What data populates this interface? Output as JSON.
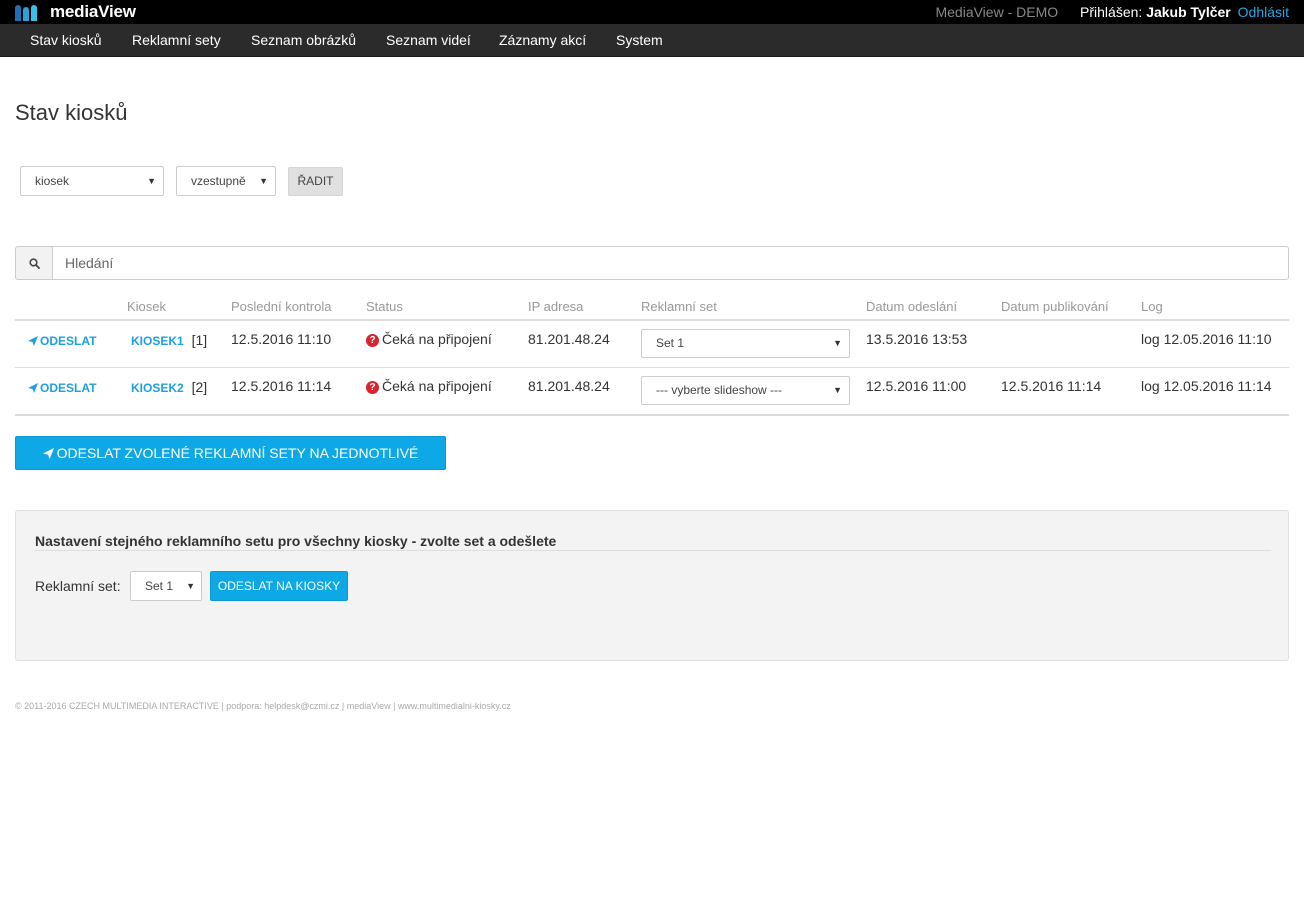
{
  "app": {
    "name": "mediaView",
    "demo_label": "MediaView - DEMO",
    "login_label": "Přihlášen: ",
    "user": "Jakub Tylčer",
    "logout": "Odhlásit"
  },
  "nav": [
    {
      "label": "Stav kiosků"
    },
    {
      "label": "Reklamní sety"
    },
    {
      "label": "Seznam obrázků"
    },
    {
      "label": "Seznam videí"
    },
    {
      "label": "Záznamy akcí"
    },
    {
      "label": "System"
    }
  ],
  "page_title": "Stav kiosků",
  "sort": {
    "field_value": "kiosek",
    "order_value": "vzestupně",
    "sort_button": "ŘADIT"
  },
  "search": {
    "placeholder": "Hledání",
    "icon": "search-icon"
  },
  "table": {
    "headers": [
      "Kiosek",
      "Poslední kontrola",
      "Status",
      "IP adresa",
      "Reklamní set",
      "Datum odeslání",
      "Datum publikování",
      "Log"
    ],
    "rows": [
      {
        "action": "ODESLAT",
        "kiosk": "KIOSEK1",
        "kiosk_id": "[1]",
        "last_check": "12.5.2016 11:10",
        "status": "Čeká na připojení",
        "ip": "81.201.48.24",
        "set": "Set 1",
        "sent": "13.5.2016 13:53",
        "published": "",
        "log": "log 12.05.2016 11:10"
      },
      {
        "action": "ODESLAT",
        "kiosk": "KIOSEK2",
        "kiosk_id": "[2]",
        "last_check": "12.5.2016 11:14",
        "status": "Čeká na připojení",
        "ip": "81.201.48.24",
        "set": "--- vyberte slideshow ---",
        "sent": "12.5.2016 11:00",
        "published": "12.5.2016 11:14",
        "log": "log 12.05.2016 11:14"
      }
    ]
  },
  "send_all_button": "ODESLAT ZVOLENÉ REKLAMNÍ SETY NA JEDNOTLIVÉ KIOSKY",
  "panel": {
    "title": "Nastavení stejného reklamního setu pro všechny kiosky - zvolte set a odešlete",
    "label": "Reklamní set:",
    "select_value": "Set 1",
    "button": "ODESLAT NA KIOSKY"
  },
  "footer": "© 2011-2016 CZECH MULTIMEDIA INTERACTIVE | podpora: helpdesk@czmi.cz | mediaView | www.multimedialni-kiosky.cz",
  "colors": {
    "accent": "#0fa8e6",
    "link": "#1ea0e0",
    "status_error": "#d9232e",
    "topbar": "#000000",
    "nav": "#2b2b2b"
  }
}
